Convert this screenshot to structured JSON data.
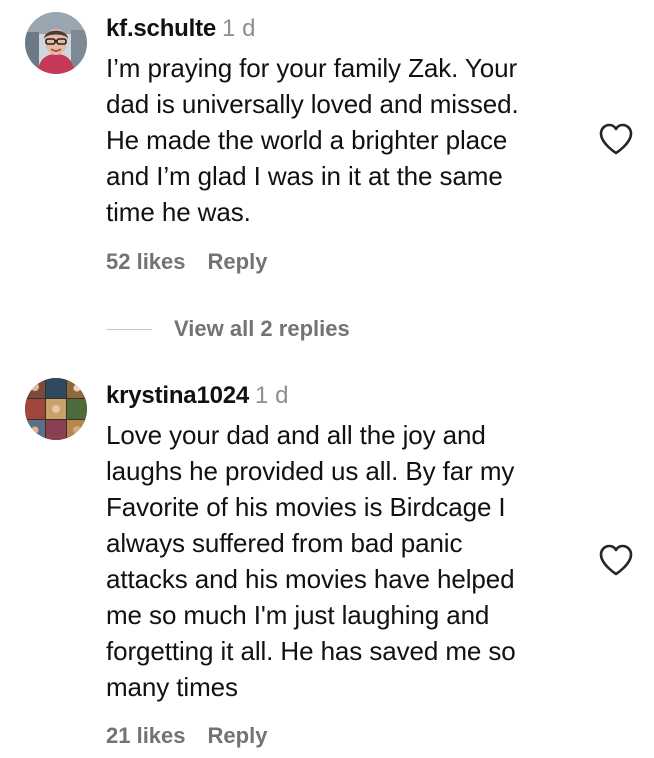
{
  "comments": [
    {
      "username": "kf.schulte",
      "time": "1 d",
      "lines": [
        "I’m praying for your family Zak. Your",
        "dad is universally loved and missed.",
        "He made the world a brighter place",
        "and I’m glad I was in it at the same",
        "time he was."
      ],
      "likes": "52 likes",
      "reply": "Reply",
      "avatar_icon": "person-photo-avatar",
      "like_icon": "heart-outline-icon"
    },
    {
      "username": "krystina1024",
      "time": "1 d",
      "lines": [
        "Love your dad and all the joy and",
        "laughs he provided us all. By far my",
        "Favorite of his movies is Birdcage I",
        "always suffered from bad panic",
        "attacks and his movies have helped",
        "me so much I'm just laughing and",
        "forgetting it all. He has saved me so",
        "many times"
      ],
      "likes": "21 likes",
      "reply": "Reply",
      "avatar_icon": "photo-collage-avatar",
      "like_icon": "heart-outline-icon"
    }
  ],
  "view_replies": "View all 2 replies",
  "colors": {
    "text": "#111111",
    "secondary": "#737373",
    "timestamp": "#8e8e8e",
    "divider": "#c7c7c7"
  }
}
